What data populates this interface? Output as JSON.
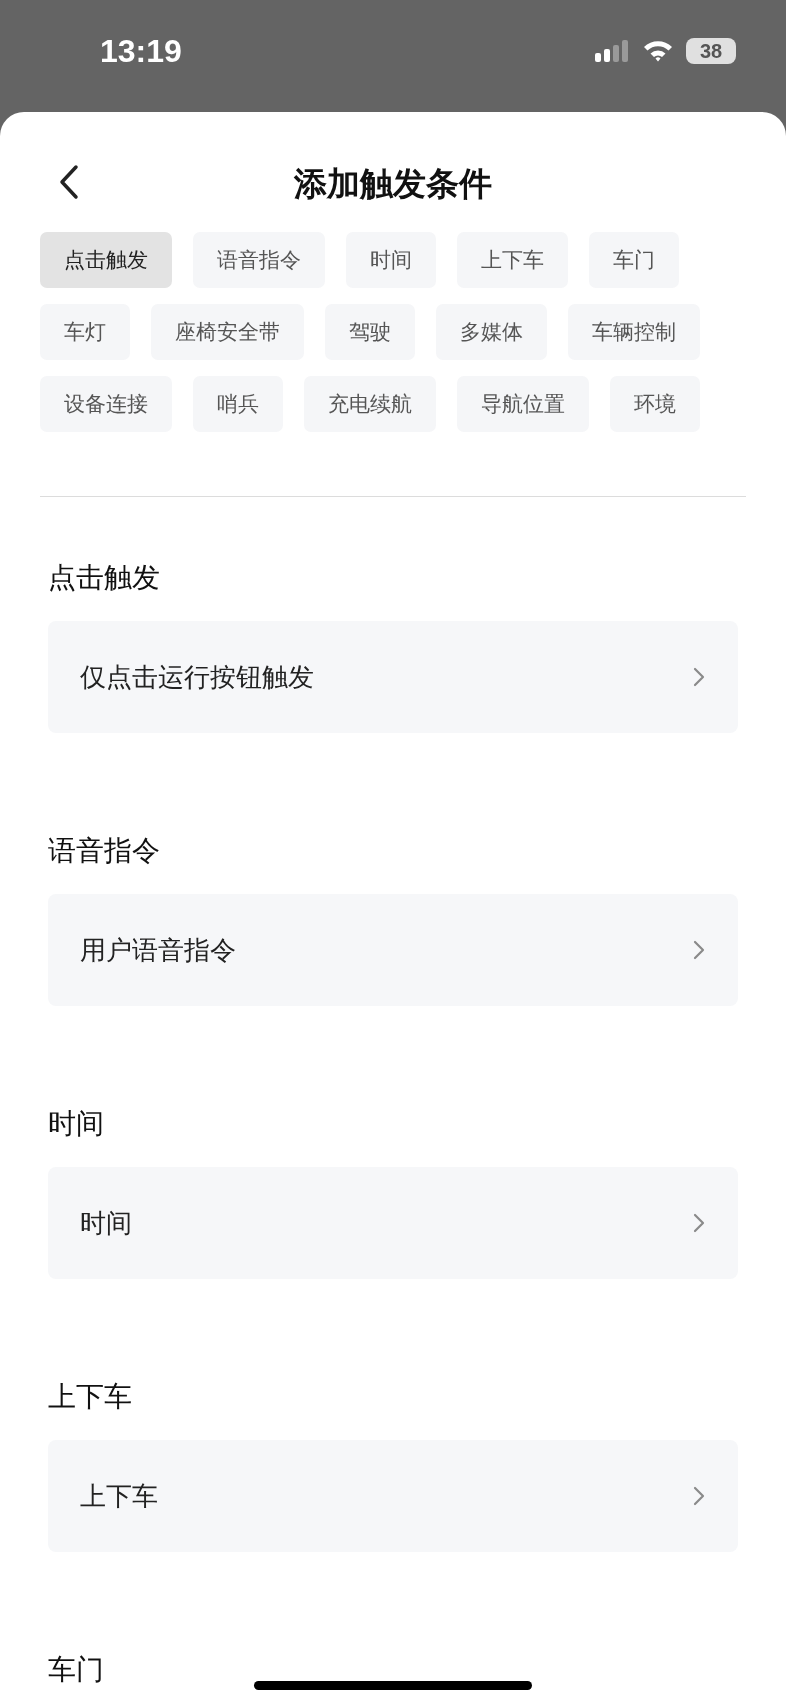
{
  "status_bar": {
    "time": "13:19",
    "battery": "38"
  },
  "header": {
    "title": "添加触发条件"
  },
  "tabs": [
    {
      "label": "点击触发",
      "selected": true
    },
    {
      "label": "语音指令",
      "selected": false
    },
    {
      "label": "时间",
      "selected": false
    },
    {
      "label": "上下车",
      "selected": false
    },
    {
      "label": "车门",
      "selected": false
    },
    {
      "label": "车灯",
      "selected": false
    },
    {
      "label": "座椅安全带",
      "selected": false
    },
    {
      "label": "驾驶",
      "selected": false
    },
    {
      "label": "多媒体",
      "selected": false
    },
    {
      "label": "车辆控制",
      "selected": false
    },
    {
      "label": "设备连接",
      "selected": false
    },
    {
      "label": "哨兵",
      "selected": false
    },
    {
      "label": "充电续航",
      "selected": false
    },
    {
      "label": "导航位置",
      "selected": false
    },
    {
      "label": "环境",
      "selected": false
    }
  ],
  "sections": [
    {
      "title": "点击触发",
      "items": [
        "仅点击运行按钮触发"
      ]
    },
    {
      "title": "语音指令",
      "items": [
        "用户语音指令"
      ]
    },
    {
      "title": "时间",
      "items": [
        "时间"
      ]
    },
    {
      "title": "上下车",
      "items": [
        "上下车"
      ]
    },
    {
      "title": "车门"
    }
  ]
}
